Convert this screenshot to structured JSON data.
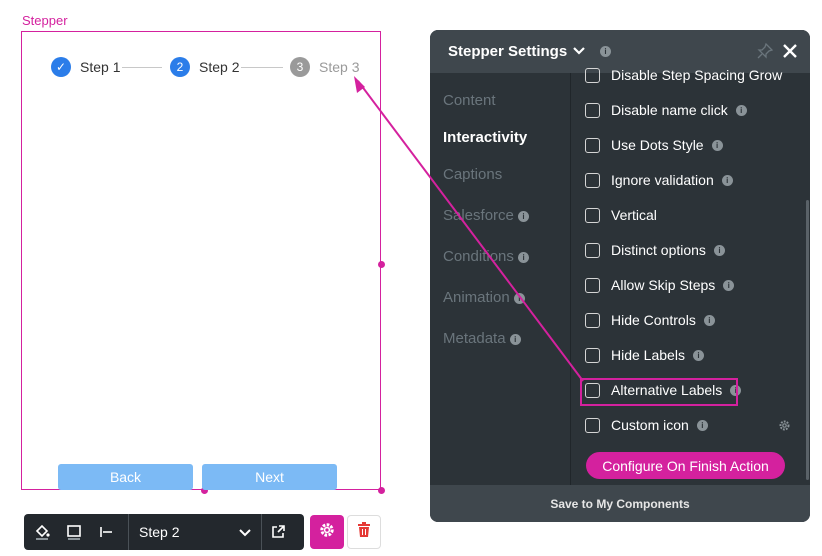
{
  "canvas": {
    "component_label": "Stepper",
    "steps": [
      {
        "label": "Step 1",
        "state": "done",
        "marker": "✓"
      },
      {
        "label": "Step 2",
        "state": "current",
        "marker": "2"
      },
      {
        "label": "Step 3",
        "state": "upcoming",
        "marker": "3"
      }
    ],
    "back_label": "Back",
    "next_label": "Next"
  },
  "toolbar": {
    "selected_step": "Step 2",
    "icons": [
      "paint-bucket-icon",
      "border-icon",
      "align-left-icon",
      "chevron-down-icon",
      "external-link-icon",
      "gear-icon",
      "trash-icon"
    ]
  },
  "panel": {
    "title": "Stepper Settings",
    "info_glyph": "i",
    "nav": [
      {
        "label": "Content",
        "active": false,
        "info": false
      },
      {
        "label": "Interactivity",
        "active": true,
        "info": false
      },
      {
        "label": "Captions",
        "active": false,
        "info": false
      },
      {
        "label": "Salesforce",
        "active": false,
        "info": true
      },
      {
        "label": "Conditions",
        "active": false,
        "info": true
      },
      {
        "label": "Animation",
        "active": false,
        "info": true
      },
      {
        "label": "Metadata",
        "active": false,
        "info": true
      }
    ],
    "options": [
      {
        "label": "Disable Step Spacing Grow",
        "checked": false,
        "info": false
      },
      {
        "label": "Disable name click",
        "checked": false,
        "info": true
      },
      {
        "label": "Use Dots Style",
        "checked": false,
        "info": true
      },
      {
        "label": "Ignore validation",
        "checked": false,
        "info": true
      },
      {
        "label": "Vertical",
        "checked": false,
        "info": false
      },
      {
        "label": "Distinct options",
        "checked": false,
        "info": true
      },
      {
        "label": "Allow Skip Steps",
        "checked": false,
        "info": true
      },
      {
        "label": "Hide Controls",
        "checked": false,
        "info": true
      },
      {
        "label": "Hide Labels",
        "checked": false,
        "info": true
      },
      {
        "label": "Alternative Labels",
        "checked": false,
        "info": true
      },
      {
        "label": "Custom icon",
        "checked": false,
        "info": true
      }
    ],
    "configure_label": "Configure On Finish Action",
    "footer_label": "Save to My Components"
  },
  "colors": {
    "accent": "#d4219e",
    "step_blue": "#2b7de9",
    "button_blue": "#7cbaf5",
    "panel_bg": "#2c3338",
    "panel_header": "#3f474d"
  }
}
